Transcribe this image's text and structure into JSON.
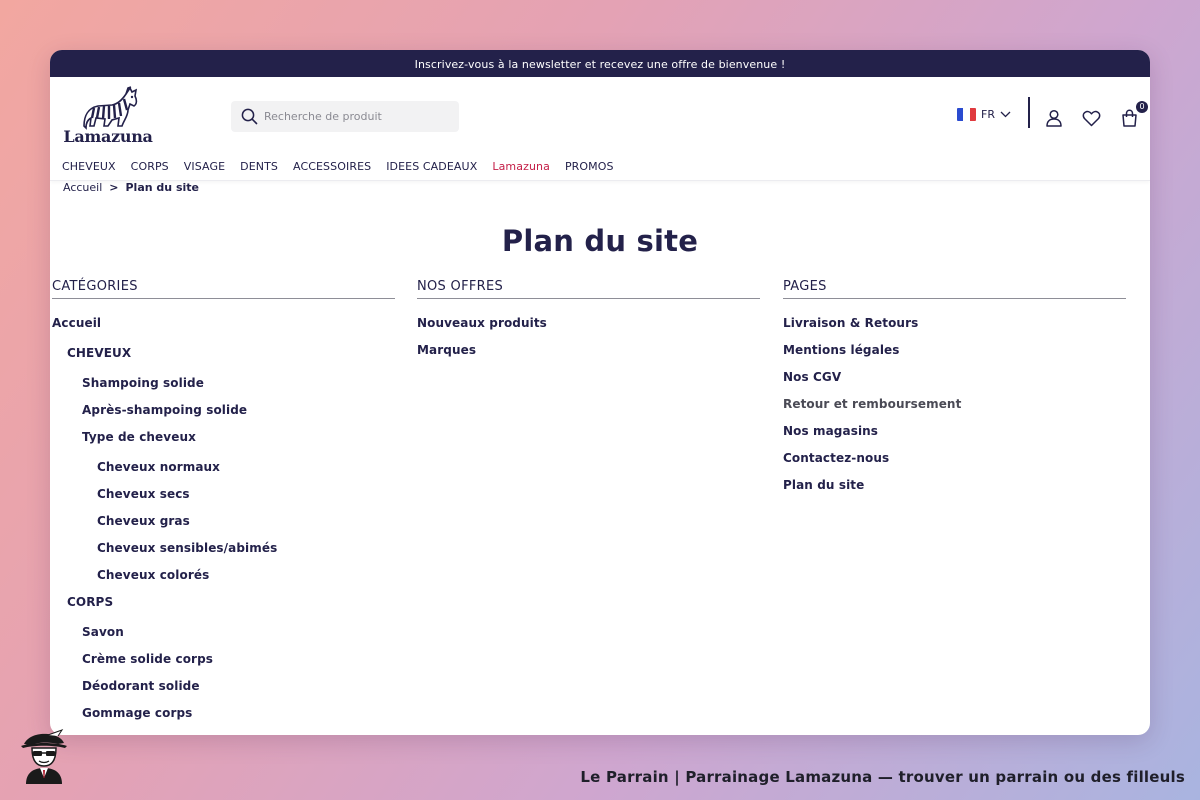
{
  "topbar": {
    "message": "Inscrivez-vous à la newsletter et recevez une offre de bienvenue !"
  },
  "header": {
    "logo_text": "Lamazuna",
    "search_placeholder": "Recherche de produit",
    "language": "FR",
    "cart_count": "0"
  },
  "nav": {
    "items": [
      "CHEVEUX",
      "CORPS",
      "VISAGE",
      "DENTS",
      "ACCESSOIRES",
      "IDEES CADEAUX",
      "Lamazuna",
      "PROMOS"
    ]
  },
  "breadcrumb": {
    "home": "Accueil",
    "separator": ">",
    "current": "Plan du site"
  },
  "page": {
    "title": "Plan du site"
  },
  "columns": {
    "categories": {
      "heading": "CATÉGORIES",
      "items": [
        "Accueil",
        "CHEVEUX",
        "Shampoing solide",
        "Après-shampoing solide",
        "Type de cheveux",
        "Cheveux normaux",
        "Cheveux secs",
        "Cheveux gras",
        "Cheveux sensibles/abimés",
        "Cheveux colorés",
        "CORPS",
        "Savon",
        "Crème solide corps",
        "Déodorant solide",
        "Gommage corps"
      ]
    },
    "offers": {
      "heading": "NOS OFFRES",
      "items": [
        "Nouveaux produits",
        "Marques"
      ]
    },
    "pages": {
      "heading": "PAGES",
      "items": [
        "Livraison & Retours",
        "Mentions légales",
        "Nos CGV",
        "Retour et remboursement",
        "Nos magasins",
        "Contactez-nous",
        "Plan du site"
      ]
    }
  },
  "footer": {
    "caption": "Le Parrain | Parrainage Lamazuna — trouver un parrain ou des filleuls"
  },
  "colors": {
    "navy": "#23214a",
    "brand_red": "#c41e47",
    "flag_blue": "#2a4bd0",
    "flag_red": "#e03a3e"
  },
  "icons": [
    "search-icon",
    "chevron-down-icon",
    "user-icon",
    "heart-icon",
    "shopping-bag-icon",
    "zebra-logo-icon",
    "parrain-mascot-icon"
  ]
}
